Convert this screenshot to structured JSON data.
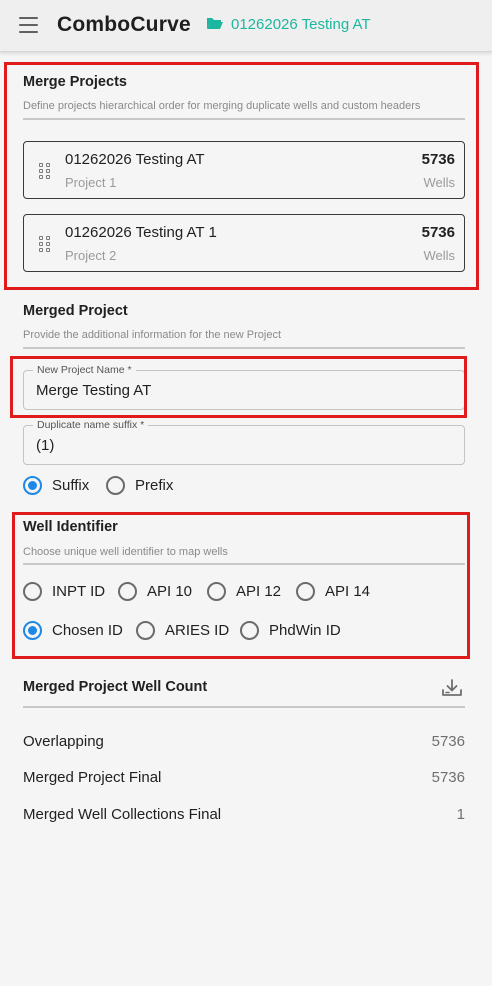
{
  "header": {
    "brand": "ComboCurve",
    "project": "01262026 Testing AT",
    "accent": "#1db7a0"
  },
  "merge_projects": {
    "title": "Merge Projects",
    "description": "Define projects hierarchical order for merging duplicate wells and custom headers",
    "projects": [
      {
        "name": "01262026 Testing AT",
        "order": "Project 1",
        "count": "5736",
        "unit": "Wells"
      },
      {
        "name": "01262026 Testing AT 1",
        "order": "Project 2",
        "count": "5736",
        "unit": "Wells"
      }
    ]
  },
  "merged_project": {
    "title": "Merged Project",
    "description": "Provide the additional information for the new Project",
    "name_field": {
      "label": "New Project Name *",
      "value": "Merge Testing AT"
    },
    "suffix_field": {
      "label": "Duplicate name suffix *",
      "value": "(1)"
    },
    "position_options": [
      {
        "label": "Suffix",
        "selected": true
      },
      {
        "label": "Prefix",
        "selected": false
      }
    ]
  },
  "well_identifier": {
    "title": "Well Identifier",
    "description": "Choose unique well identifier to map wells",
    "options": [
      {
        "label": "INPT ID",
        "selected": false
      },
      {
        "label": "API 10",
        "selected": false
      },
      {
        "label": "API 12",
        "selected": false
      },
      {
        "label": "API 14",
        "selected": false
      },
      {
        "label": "Chosen ID",
        "selected": true
      },
      {
        "label": "ARIES ID",
        "selected": false
      },
      {
        "label": "PhdWin ID",
        "selected": false
      }
    ]
  },
  "well_count": {
    "title": "Merged Project Well Count",
    "download_icon": "download-icon",
    "rows": [
      {
        "label": "Overlapping",
        "value": "5736"
      },
      {
        "label": "Merged Project Final",
        "value": "5736"
      },
      {
        "label": "Merged Well Collections Final",
        "value": "1"
      }
    ]
  },
  "colors": {
    "highlight": "#e01b1b",
    "radio_selected": "#1e88e5"
  }
}
